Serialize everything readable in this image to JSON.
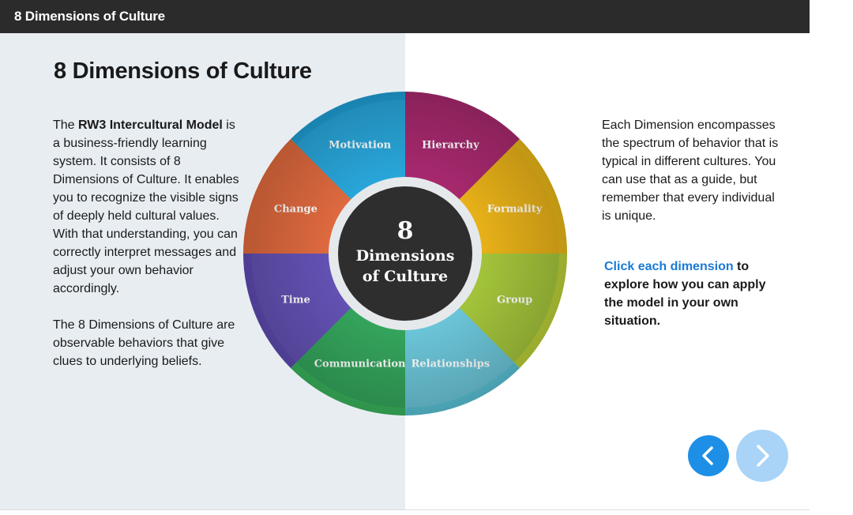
{
  "window": {
    "title": "8 Dimensions of Culture"
  },
  "page": {
    "heading": "8 Dimensions of Culture"
  },
  "left_text": {
    "p1_before": "The ",
    "p1_bold": "RW3 Intercultural Model",
    "p1_after": " is a business-friendly learning system. It consists of 8 Dimensions of Culture. It enables you to recognize the visible signs of deeply held cultural values. With that understanding, you can correctly interpret messages and adjust your own behavior accordingly.",
    "p2": "The 8 Dimensions of Culture are observable behaviors that give clues to underlying beliefs."
  },
  "right_text": {
    "p1": "Each Dimension encompasses the spectrum of behavior that is typical in different cultures. You can use that as a guide, but remember that every individual is unique.",
    "cta_link": "Click each dimension",
    "cta_rest": " to explore how you can apply the model in your own situation."
  },
  "wheel": {
    "center_number": "8",
    "center_line1": "Dimensions",
    "center_line2": "of Culture",
    "segments": [
      {
        "label": "Motivation",
        "color": "#2aa8db",
        "ring": "#1f9fd6",
        "icon": "photo-woman-laughing"
      },
      {
        "label": "Hierarchy",
        "color": "#a8296f",
        "ring": "#a8296f",
        "icon": "photo-business-people"
      },
      {
        "label": "Formality",
        "color": "#e8b21a",
        "ring": "#eab718",
        "icon": "photo-man-smiling"
      },
      {
        "label": "Group",
        "color": "#a3c43b",
        "ring": "#bcd138",
        "icon": "photo-crowd"
      },
      {
        "label": "Relationships",
        "color": "#6ec6d9",
        "ring": "#59c2d6",
        "icon": "photo-woman-portrait"
      },
      {
        "label": "Communication",
        "color": "#34a45c",
        "ring": "#3ab35c",
        "icon": "photo-woman-phone"
      },
      {
        "label": "Time",
        "color": "#6553b5",
        "ring": "#5e4bb2",
        "icon": "photo-clock-city"
      },
      {
        "label": "Change",
        "color": "#e06a3f",
        "ring": "#e26b3c",
        "icon": "photo-woman-talking"
      }
    ]
  },
  "nav": {
    "prev_icon": "chevron-left-icon",
    "next_icon": "chevron-right-icon"
  }
}
